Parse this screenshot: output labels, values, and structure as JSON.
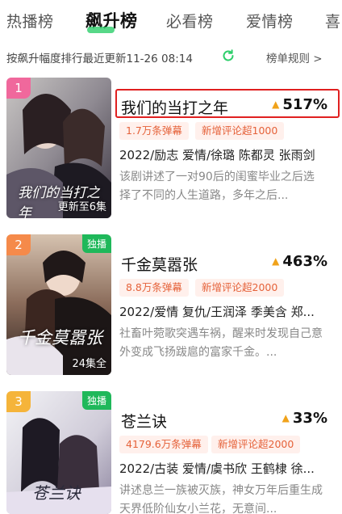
{
  "tabs": [
    "热播榜",
    "飙升榜",
    "必看榜",
    "爱情榜",
    "喜"
  ],
  "subheader": {
    "update_text": "按飙升幅度排行最近更新11-26 08:14",
    "rules_label": "榜单规则 >"
  },
  "items": [
    {
      "rank": "1",
      "title": "我们的当打之年",
      "growth": "517%",
      "tags": [
        "1.7万条弹幕",
        "新增评论超1000"
      ],
      "meta": "2022/励志 爱情/徐璐 陈都灵 张雨剑",
      "desc": "该剧讲述了一对90后的闺蜜毕业之后选择了不同的人生道路，多年之后...",
      "episode": "更新至6集",
      "exclusive": "",
      "poster_title": "我们的当打之年",
      "rank_color": "#f0689c"
    },
    {
      "rank": "2",
      "title": "千金莫嚣张",
      "growth": "463%",
      "tags": [
        "8.8万条弹幕",
        "新增评论超2000"
      ],
      "meta": "2022/爱情 复仇/王润泽 季美含 郑...",
      "desc": "社畜叶菀歌突遇车祸，醒来时发现自己意外变成飞扬跋扈的富家千金。...",
      "episode": "24集全",
      "exclusive": "独播",
      "poster_title": "千金莫嚣张",
      "rank_color": "#f58a4a"
    },
    {
      "rank": "3",
      "title": "苍兰诀",
      "growth": "33%",
      "tags": [
        "4179.6万条弹幕",
        "新增评论超2000"
      ],
      "meta": "2022/古装 爱情/虞书欣 王鹤棣 徐...",
      "desc": "讲述息兰一族被灭族，神女万年后重生成天界低阶仙女小兰花，无意间...",
      "episode": "",
      "exclusive": "独播",
      "poster_title": "苍兰诀",
      "rank_color": "#f5b43a"
    }
  ],
  "colors": {
    "accent": "#2dce6a",
    "highlight": "#e02020",
    "tag_text": "#e5623a",
    "growth_arrow": "#f0a21a"
  }
}
